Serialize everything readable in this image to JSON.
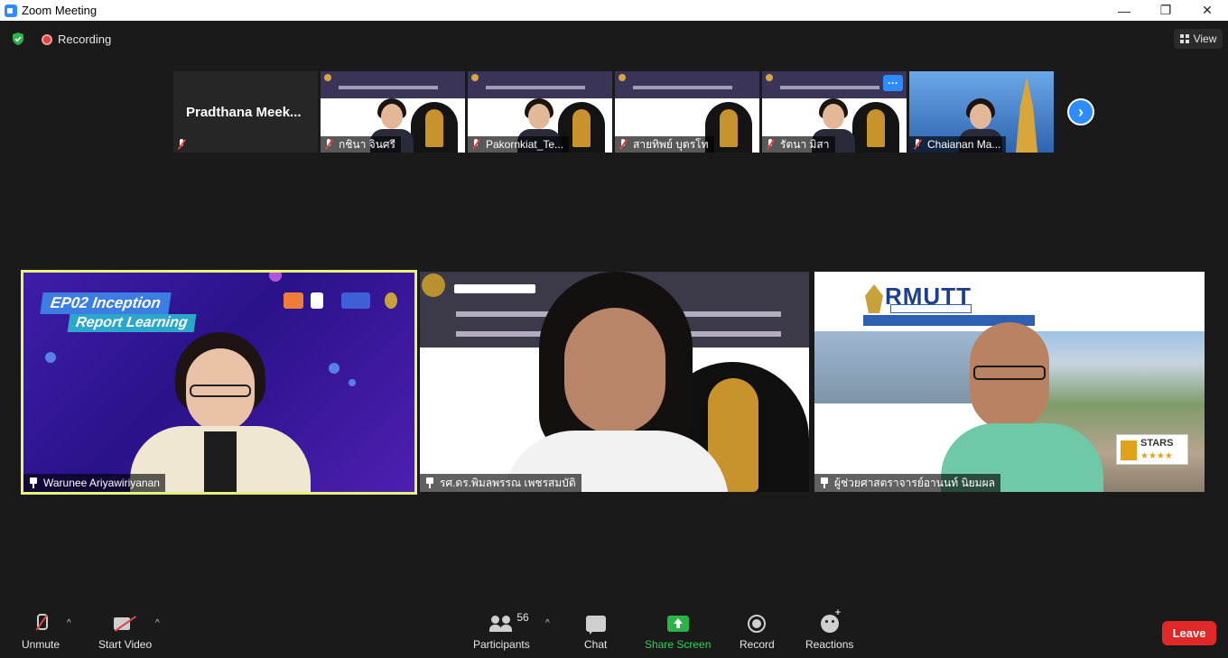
{
  "window": {
    "title": "Zoom Meeting",
    "minimize": "—",
    "maximize": "❐",
    "close": "✕"
  },
  "status": {
    "recording_label": "Recording",
    "view_label": "View"
  },
  "thumbnails": [
    {
      "name": "Pradthana Meek...",
      "muted": true,
      "video": false
    },
    {
      "name": "กชินา จินศรี",
      "muted": true,
      "video": true
    },
    {
      "name": "Pakornkiat_Te...",
      "muted": true,
      "video": true
    },
    {
      "name": "สายทิพย์ บุตรโท",
      "muted": true,
      "video": true
    },
    {
      "name": "รัตนา มิสา",
      "muted": true,
      "video": true
    },
    {
      "name": "Chaianan Ma...",
      "muted": true,
      "video": true
    }
  ],
  "thumb_more_label": "···",
  "next_page_label": "›",
  "tiles": [
    {
      "name": "Warunee Ariyawiriyanan",
      "active_speaker": true
    },
    {
      "name": "รศ.ดร.พิมลพรรณ เพชรสมบัติ",
      "active_speaker": false
    },
    {
      "name": "ผู้ช่วยศาสตราจารย์อานนท์ นิยมผล",
      "active_speaker": false
    }
  ],
  "tile1_banner": {
    "line1": "EP02 Inception",
    "line2": "Report Learning"
  },
  "tile3_banner": {
    "logo": "RMUTT",
    "badge": "STARS",
    "badge_rating": "★★★★"
  },
  "toolbar": {
    "unmute_label": "Unmute",
    "start_video_label": "Start Video",
    "participants_label": "Participants",
    "participants_count": "56",
    "chat_label": "Chat",
    "share_screen_label": "Share Screen",
    "record_label": "Record",
    "reactions_label": "Reactions",
    "leave_label": "Leave",
    "caret": "^"
  },
  "colors": {
    "accent_blue": "#2d8cff",
    "share_green": "#2bb34a",
    "leave_red": "#e02828",
    "active_speaker_border": "#e6f27a"
  }
}
